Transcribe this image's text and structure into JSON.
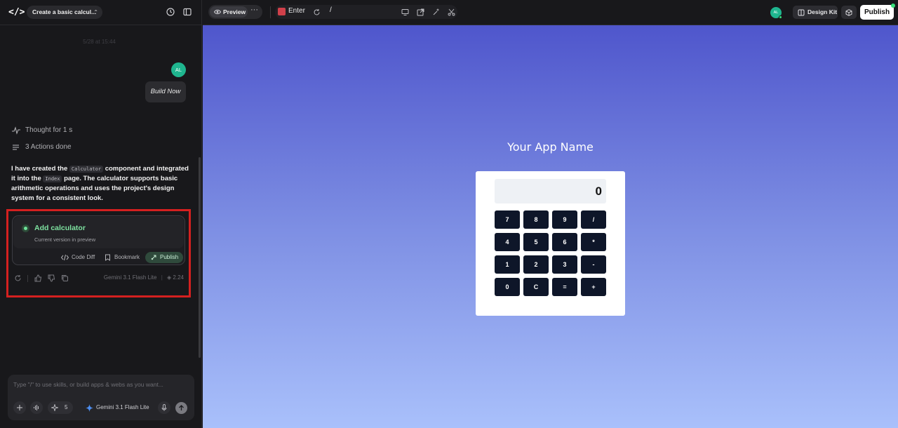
{
  "sidebar": {
    "project_title": "Create a basic calcul...",
    "timestamp": "5/28 at 15:44",
    "user_avatar": "AL",
    "user_message": "Build Now",
    "thought": "Thought for 1 s",
    "actions": "3 Actions done",
    "ai_message": {
      "p1": "I have created the",
      "code1": "Calculator",
      "p2": "component and integrated it into the",
      "code2": "Index",
      "p3": "page. The calculator supports basic arithmetic operations and uses the project's design system for a consistent look."
    },
    "version_card": {
      "title": "Add calculator",
      "subtitle": "Current version in preview",
      "code_diff": "Code Diff",
      "bookmark": "Bookmark",
      "publish": "Publish"
    },
    "model_name": "Gemini 3.1 Flash Lite",
    "credits": "2.24",
    "input_placeholder": "Type \"/\" to use skills, or build apps & webs as you want...",
    "skills_count": "5",
    "input_model": "Gemini 3.1 Flash Lite"
  },
  "topbar": {
    "preview_tab": "Preview",
    "route_name": "Enter",
    "url_path": "/",
    "avatar": "AL",
    "design_kit": "Design Kit",
    "publish": "Publish"
  },
  "app_preview": {
    "title": "Your App Name",
    "display": "0",
    "keys": [
      [
        "7",
        "8",
        "9",
        "/"
      ],
      [
        "4",
        "5",
        "6",
        "*"
      ],
      [
        "1",
        "2",
        "3",
        "-"
      ],
      [
        "0",
        "C",
        "=",
        "+"
      ]
    ]
  },
  "colors": {
    "accent_green": "#7ee2a0",
    "highlight_red": "#d42020",
    "calc_key": "#0e1629",
    "gradient_top": "#4f56cc",
    "gradient_bottom": "#a9c0fb"
  }
}
